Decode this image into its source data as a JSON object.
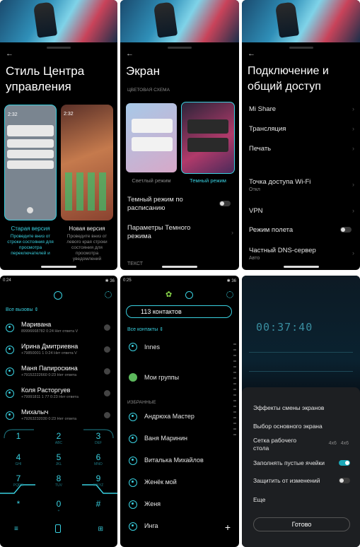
{
  "panel1": {
    "title": "Стиль Центра управления",
    "option_old": {
      "time": "2:32",
      "label": "Старая версия",
      "desc": "Проведите вниз от строки состояния для просмотра переключателей и"
    },
    "option_new": {
      "time": "2:32",
      "label": "Новая версия",
      "desc": "Проведите вниз от левого края строки состояния для просмотра уведомлений"
    }
  },
  "panel2": {
    "title": "Экран",
    "section": "ЦВЕТОВАЯ СХЕМА",
    "light_label": "Светлый режим",
    "dark_label": "Темный режим",
    "row1": "Темный режим по расписанию",
    "row2": "Параметры Темного режима",
    "row3": "ТЕКСТ"
  },
  "panel3": {
    "title": "Подключение и общий доступ",
    "items": [
      {
        "label": "Mi Share",
        "sub": ""
      },
      {
        "label": "Трансляция",
        "sub": ""
      },
      {
        "label": "Печать",
        "sub": ""
      },
      {
        "label": "Точка доступа Wi-Fi",
        "sub": "Откл"
      },
      {
        "label": "VPN",
        "sub": ""
      },
      {
        "label": "Режим полета",
        "sub": ""
      },
      {
        "label": "Частный DNS-сервер",
        "sub": "Авто"
      }
    ]
  },
  "panel4": {
    "status_time": "0:24",
    "status_right": "✱ 36",
    "filter": "Все вызовы",
    "calls": [
      {
        "name": "Маривана",
        "detail": "89996668782  0:24 Нет ответа V"
      },
      {
        "name": "Ирина Дмитриевна",
        "detail": "+79850001 1 0:24 Нет ответа V"
      },
      {
        "name": "Маня Папироскина",
        "detail": "+79152222660 0:23 Нет ответа"
      },
      {
        "name": "Коля Расторгуев",
        "detail": "+79991811 1 77 0:23 Нет ответа"
      },
      {
        "name": "Михалыч",
        "detail": "+79263232030 0:23 Нет ответа"
      }
    ],
    "keys": [
      {
        "digit": "1",
        "sub": ""
      },
      {
        "digit": "2",
        "sub": "ABC"
      },
      {
        "digit": "3",
        "sub": "DEF"
      },
      {
        "digit": "4",
        "sub": "GHI"
      },
      {
        "digit": "5",
        "sub": "JKL"
      },
      {
        "digit": "6",
        "sub": "MNO"
      },
      {
        "digit": "7",
        "sub": "PQRS"
      },
      {
        "digit": "8",
        "sub": "TUV"
      },
      {
        "digit": "9",
        "sub": "WXYZ"
      },
      {
        "digit": "*",
        "sub": ""
      },
      {
        "digit": "0",
        "sub": "+"
      },
      {
        "digit": "#",
        "sub": ""
      }
    ]
  },
  "panel5": {
    "status_time": "0:25",
    "status_right": "✱ 36",
    "count": "113 контактов",
    "filter": "Все контакты",
    "first": "Innes",
    "groups": "Мои группы",
    "favorites_header": "ИЗБРАННЫЕ",
    "favorites": [
      "Андрюха Мастер",
      "Ваня Маринин",
      "Виталька Михайлов",
      "Женёк мой",
      "Женя",
      "Инга"
    ],
    "add": "+"
  },
  "panel6": {
    "clock": "00:37:40",
    "items": [
      {
        "label": "Эффекты смены экранов",
        "value": ""
      },
      {
        "label": "Выбор основного экрана",
        "value": ""
      },
      {
        "label": "Сетка рабочего стола",
        "value": "4x6   4x6"
      },
      {
        "label": "Заполнять пустые ячейки",
        "value": ""
      },
      {
        "label": "Защитить от изменений",
        "value": ""
      },
      {
        "label": "Еще",
        "value": ""
      }
    ],
    "done": "Готово"
  }
}
